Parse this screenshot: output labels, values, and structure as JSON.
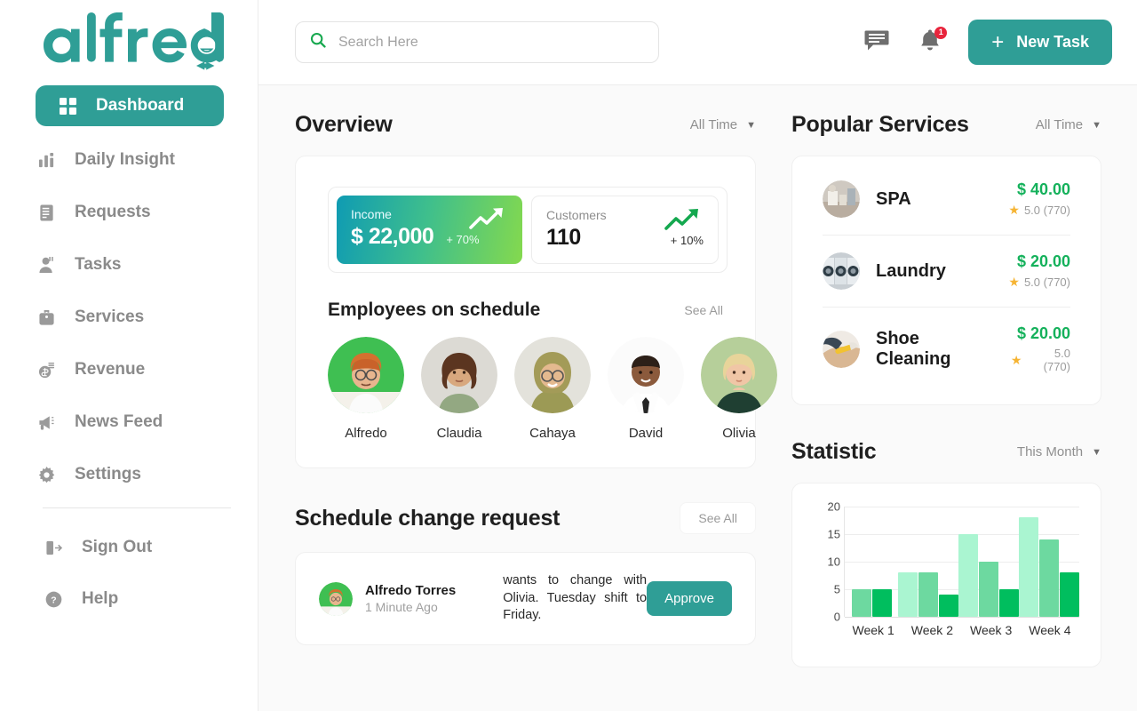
{
  "brand": {
    "name": "alfred",
    "accent": "#2f9e96"
  },
  "sidebar": {
    "items": [
      {
        "label": "Dashboard",
        "icon": "grid-icon",
        "active": true
      },
      {
        "label": "Daily Insight",
        "icon": "bar-chart-icon"
      },
      {
        "label": "Requests",
        "icon": "document-list-icon"
      },
      {
        "label": "Tasks",
        "icon": "user-task-icon"
      },
      {
        "label": "Services",
        "icon": "briefcase-icon"
      },
      {
        "label": "Revenue",
        "icon": "money-icon"
      },
      {
        "label": "News Feed",
        "icon": "megaphone-icon"
      },
      {
        "label": "Settings",
        "icon": "gear-icon"
      }
    ],
    "bottom_items": [
      {
        "label": "Sign Out",
        "icon": "sign-out-icon"
      },
      {
        "label": "Help",
        "icon": "question-circle-icon"
      }
    ]
  },
  "topbar": {
    "search_placeholder": "Search Here",
    "search_value": "",
    "messages_icon": "chat-icon",
    "notifications_icon": "bell-icon",
    "notification_count": "1",
    "new_task_label": "New Task",
    "plus_glyph": "+"
  },
  "overview": {
    "title": "Overview",
    "filter": "All Time",
    "kpis": [
      {
        "label": "Income",
        "value": "$ 22,000",
        "delta": "+ 70%"
      },
      {
        "label": "Customers",
        "value": "110",
        "delta": "+ 10%"
      }
    ],
    "employees_title": "Employees on schedule",
    "see_all": "See All",
    "employees": [
      {
        "name": "Alfredo"
      },
      {
        "name": "Claudia"
      },
      {
        "name": "Cahaya"
      },
      {
        "name": "David"
      },
      {
        "name": "Olivia"
      }
    ]
  },
  "schedule": {
    "title": "Schedule change request",
    "see_all": "See All",
    "request": {
      "name": "Alfredo Torres",
      "time": "1 Minute Ago",
      "text": "wants to change with Olivia. Tuesday shift to Friday.",
      "approve_label": "Approve"
    }
  },
  "services": {
    "title": "Popular Services",
    "filter": "All Time",
    "items": [
      {
        "name": "SPA",
        "price": "$ 40.00",
        "rating": "5.0 (770)"
      },
      {
        "name": "Laundry",
        "price": "$ 20.00",
        "rating": "5.0 (770)"
      },
      {
        "name": "Shoe Cleaning",
        "price": "$ 20.00",
        "rating": "5.0 (770)"
      }
    ]
  },
  "statistic": {
    "title": "Statistic",
    "filter": "This Month"
  },
  "chart_data": {
    "type": "bar",
    "title": "Statistic",
    "categories": [
      "Week 1",
      "Week 2",
      "Week 3",
      "Week 4"
    ],
    "series": [
      {
        "name": "Series 1",
        "color": "#aaf5d1",
        "values": [
          null,
          8,
          15,
          18
        ]
      },
      {
        "name": "Series 2",
        "color": "#6dd9a0",
        "values": [
          5,
          8,
          10,
          14
        ]
      },
      {
        "name": "Series 3",
        "color": "#00be5e",
        "values": [
          5,
          4,
          5,
          8
        ]
      }
    ],
    "ylim": [
      0,
      20
    ],
    "yticks": [
      0,
      5,
      10,
      15,
      20
    ],
    "xlabel": "",
    "ylabel": "",
    "grid": true,
    "legend": "none"
  }
}
